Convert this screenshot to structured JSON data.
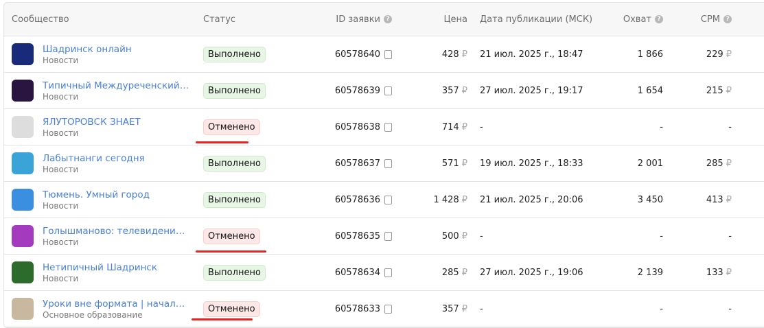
{
  "header": {
    "community": "Сообщество",
    "status": "Статус",
    "id": "ID заявки",
    "price": "Цена",
    "date": "Дата публикации (МСК)",
    "reach": "Охват",
    "cpm": "CPM"
  },
  "currency": "₽",
  "rows": [
    {
      "name": "Шадринск онлайн",
      "category": "Новости",
      "status": "Выполнено",
      "id": "60578640",
      "price": "428",
      "date": "21 июл. 2025 г., 18:47",
      "reach": "1 866",
      "cpm": "229",
      "color": "#1a2a7a"
    },
    {
      "name": "Типичный Междуреченский (...",
      "category": "Новости",
      "status": "Выполнено",
      "id": "60578639",
      "price": "357",
      "date": "27 июл. 2025 г., 19:17",
      "reach": "1 654",
      "cpm": "215",
      "color": "#2a1540"
    },
    {
      "name": "ЯЛУТОРОВСК ЗНАЕТ",
      "category": "Новости",
      "status": "Отменено",
      "id": "60578638",
      "price": "714",
      "date": "-",
      "reach": "-",
      "cpm": "-",
      "color": "#ddd"
    },
    {
      "name": "Лабытнанги сегодня",
      "category": "Новости",
      "status": "Выполнено",
      "id": "60578637",
      "price": "571",
      "date": "19 июл. 2025 г., 18:33",
      "reach": "2 001",
      "cpm": "285",
      "color": "#3aa3d8"
    },
    {
      "name": "Тюмень. Умный город",
      "category": "Новости",
      "status": "Выполнено",
      "id": "60578636",
      "price": "1 428",
      "date": "21 июл. 2025 г., 20:06",
      "reach": "3 450",
      "cpm": "413",
      "color": "#3a8fe0"
    },
    {
      "name": "Голышманово: телевидение и ...",
      "category": "Новости",
      "status": "Отменено",
      "id": "60578635",
      "price": "500",
      "date": "-",
      "reach": "-",
      "cpm": "-",
      "color": "#a43bbf"
    },
    {
      "name": "Нетипичный Шадринск",
      "category": "Новости",
      "status": "Выполнено",
      "id": "60578634",
      "price": "285",
      "date": "27 июл. 2025 г., 19:06",
      "reach": "2 139",
      "cpm": "133",
      "color": "#2d6b2d"
    },
    {
      "name": "Уроки вне формата | начальн...",
      "category": "Основное образование",
      "status": "Отменено",
      "id": "60578633",
      "price": "357",
      "date": "-",
      "reach": "-",
      "cpm": "-",
      "color": "#c9b8a0"
    }
  ]
}
